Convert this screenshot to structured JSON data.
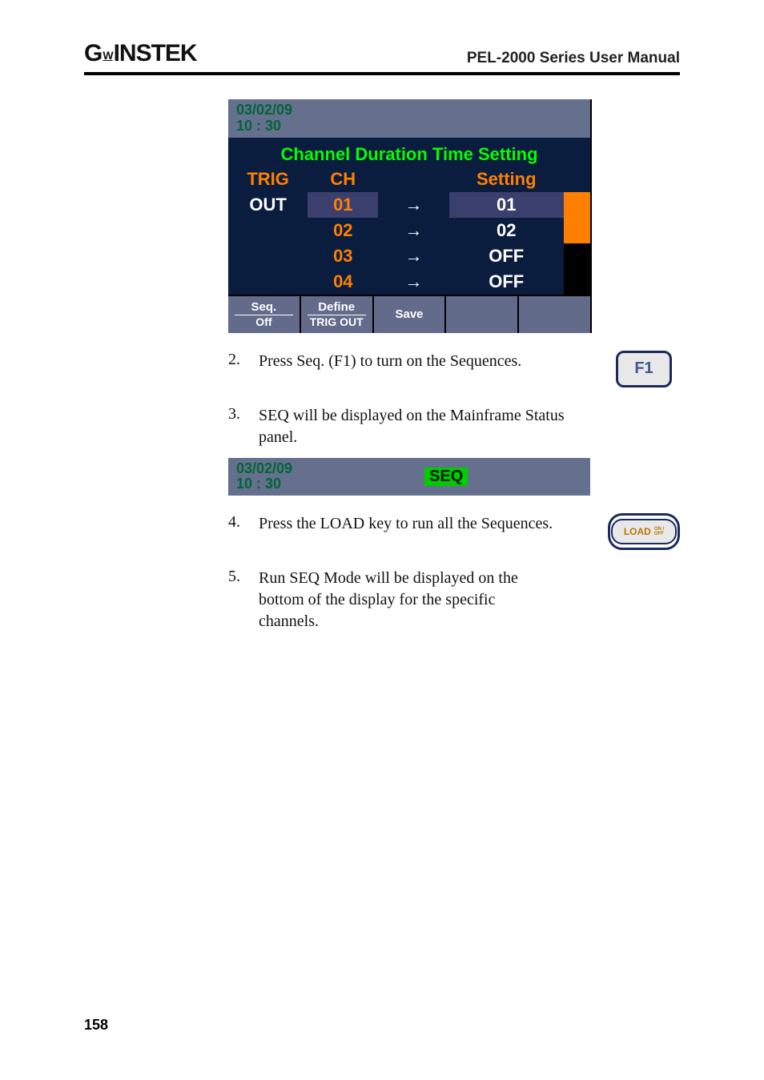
{
  "header": {
    "logo_text": "GWINSTEK",
    "manual_title": "PEL-2000 Series User Manual"
  },
  "lcd1": {
    "date": "03/02/09",
    "time": "10 : 30",
    "title": "Channel Duration Time Setting",
    "cols": {
      "trig": "TRIG",
      "ch": "CH",
      "setting": "Setting"
    },
    "out_label": "OUT",
    "rows": [
      {
        "ch": "01",
        "val": "01",
        "highlight": true,
        "side": "orange"
      },
      {
        "ch": "02",
        "val": "02",
        "highlight": false,
        "side": "orange"
      },
      {
        "ch": "03",
        "val": "OFF",
        "highlight": false,
        "side": "black"
      },
      {
        "ch": "04",
        "val": "OFF",
        "highlight": false,
        "side": "black"
      }
    ],
    "softkeys": {
      "f1_top": "Seq.",
      "f1_bot": "Off",
      "f2_top": "Define",
      "f2_bot": "TRIG OUT",
      "f3": "Save",
      "f4": "",
      "f5": ""
    }
  },
  "steps": {
    "s2_num": "2.",
    "s2_text": "Press Seq. (F1) to turn on the Sequences.",
    "f1_key": "F1",
    "s3_num": "3.",
    "s3_text": "SEQ will be displayed on the Mainframe Status panel.",
    "status_date": "03/02/09",
    "status_time": "10 : 30",
    "status_seq": "SEQ",
    "s4_num": "4.",
    "s4_text": "Press the LOAD key to run all the Sequences.",
    "load_label": "LOAD",
    "load_on": "ON /",
    "load_off": "OFF",
    "s5_num": "5.",
    "s5_text": "Run SEQ Mode will be displayed on the bottom of the display for the specific channels."
  },
  "page_number": "158"
}
